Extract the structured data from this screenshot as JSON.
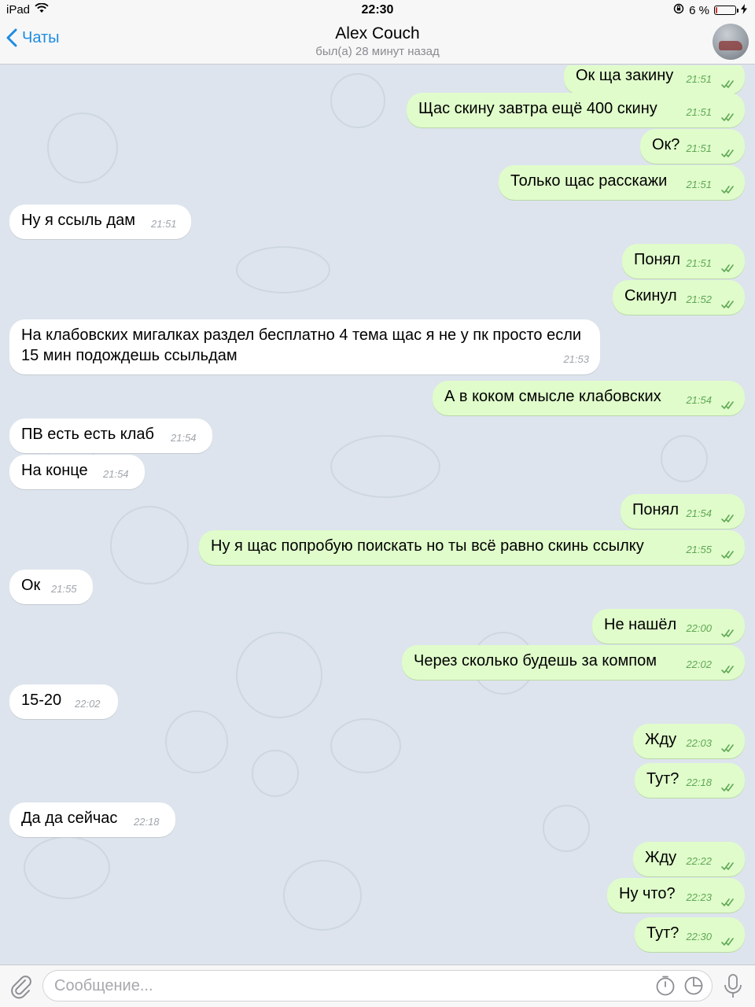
{
  "status_bar": {
    "device": "iPad",
    "time": "22:30",
    "battery": "6 %",
    "battery_level": 0.06
  },
  "header": {
    "back_label": "Чаты",
    "contact_name": "Alex Couch",
    "last_seen": "был(а) 28 минут назад"
  },
  "colors": {
    "accent": "#1d8ce0",
    "outgoing_bubble": "#e0fccb",
    "incoming_bubble": "#ffffff",
    "chat_bg": "#dde4ed",
    "read_ticks": "#5fa855"
  },
  "messages": [
    {
      "dir": "out",
      "text": "Ок ща закину",
      "time": "21:51"
    },
    {
      "dir": "out",
      "text": "Щас скину завтра ещё 400 скину",
      "time": "21:51"
    },
    {
      "dir": "out",
      "text": "Ок?",
      "time": "21:51"
    },
    {
      "dir": "out",
      "text": "Только щас расскажи",
      "time": "21:51"
    },
    {
      "dir": "in",
      "text": "Ну я ссыль дам",
      "time": "21:51"
    },
    {
      "dir": "out",
      "text": "Понял",
      "time": "21:51"
    },
    {
      "dir": "out",
      "text": "Скинул",
      "time": "21:52"
    },
    {
      "dir": "in",
      "text": "На клабовских мигалках раздел бесплатно 4 тема щас я не у пк просто если 15 мин подождешь ссыльдам",
      "time": "21:53"
    },
    {
      "dir": "out",
      "text": "А в коком смысле клабовских",
      "time": "21:54"
    },
    {
      "dir": "in",
      "text": "ПВ есть есть клаб",
      "time": "21:54"
    },
    {
      "dir": "in",
      "text": "На конце",
      "time": "21:54"
    },
    {
      "dir": "out",
      "text": "Понял",
      "time": "21:54"
    },
    {
      "dir": "out",
      "text": "Ну я щас попробую поискать но ты всё равно скинь ссылку",
      "time": "21:55"
    },
    {
      "dir": "in",
      "text": "Ок",
      "time": "21:55"
    },
    {
      "dir": "out",
      "text": "Не нашёл",
      "time": "22:00"
    },
    {
      "dir": "out",
      "text": "Через сколько будешь за компом",
      "time": "22:02"
    },
    {
      "dir": "in",
      "text": "15-20",
      "time": "22:02"
    },
    {
      "dir": "out",
      "text": "Жду",
      "time": "22:03"
    },
    {
      "dir": "out",
      "text": "Тут?",
      "time": "22:18"
    },
    {
      "dir": "in",
      "text": "Да да сейчас",
      "time": "22:18"
    },
    {
      "dir": "out",
      "text": "Жду",
      "time": "22:22"
    },
    {
      "dir": "out",
      "text": "Ну что?",
      "time": "22:23"
    },
    {
      "dir": "out",
      "text": "Тут?",
      "time": "22:30"
    }
  ],
  "composer": {
    "placeholder": "Сообщение..."
  }
}
